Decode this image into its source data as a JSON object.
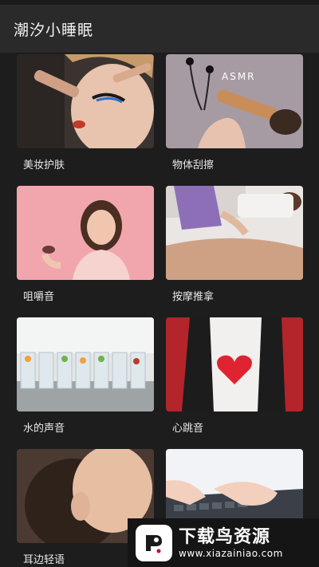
{
  "app": {
    "title": "潮汐小睡眠"
  },
  "cards": [
    {
      "label": "美妆护肤"
    },
    {
      "label": "物体刮擦"
    },
    {
      "label": "咀嚼音"
    },
    {
      "label": "按摩推拿"
    },
    {
      "label": "水的声音"
    },
    {
      "label": "心跳音"
    },
    {
      "label": "耳边轻语"
    },
    {
      "label": ""
    }
  ],
  "thumb_texts": {
    "asmr": "ASMR"
  },
  "watermark": {
    "title": "下载鸟资源",
    "url": "www.xiazainiao.com"
  }
}
